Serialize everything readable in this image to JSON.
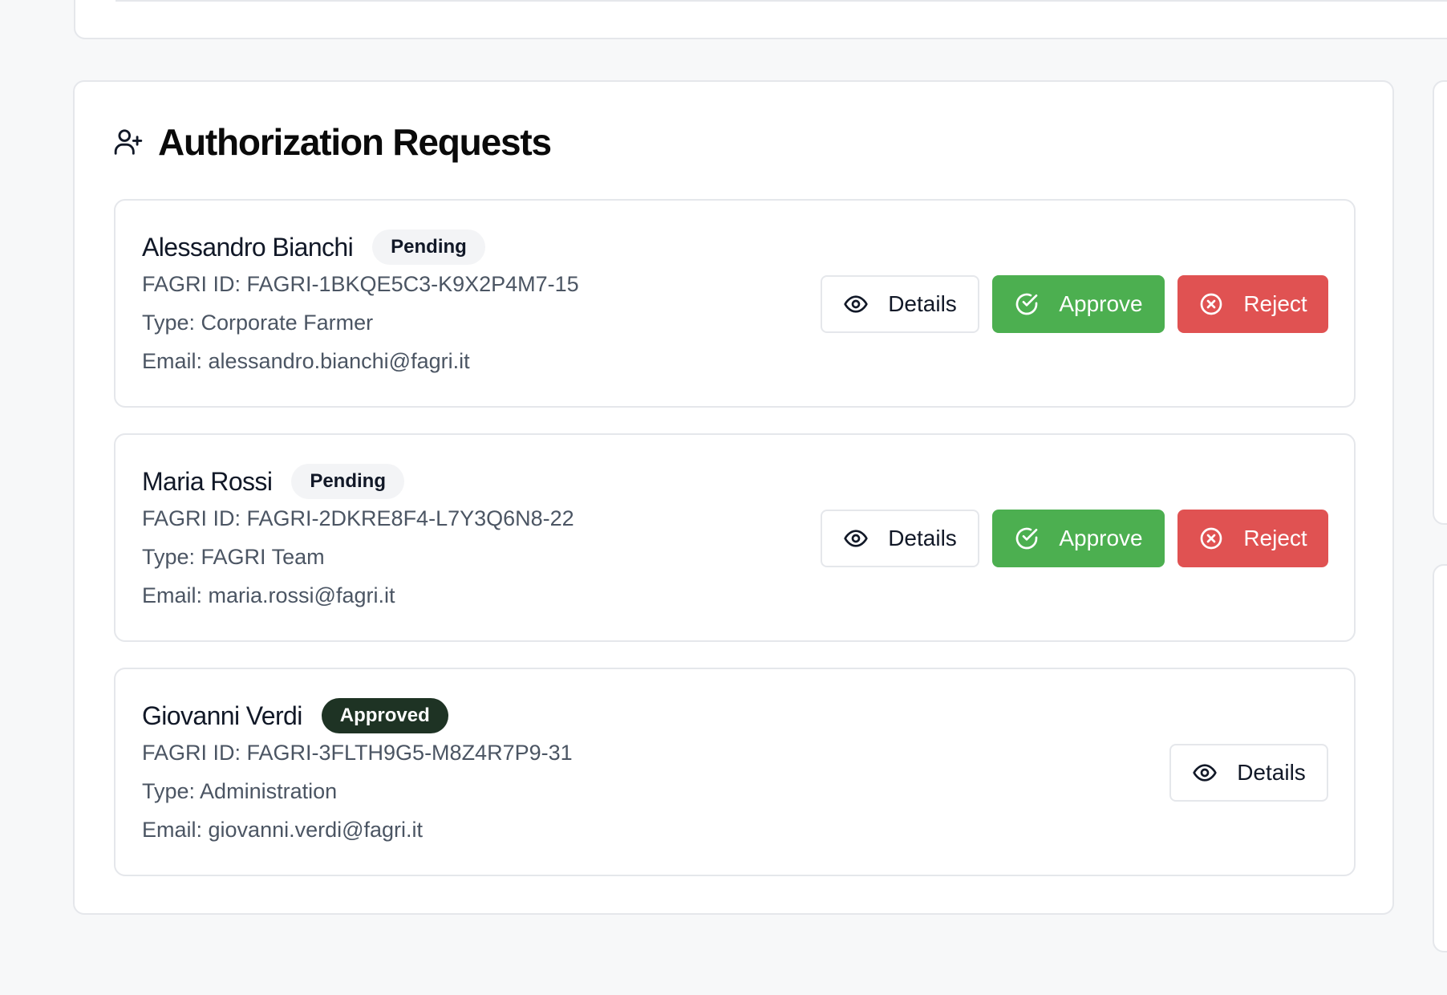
{
  "section": {
    "title": "Authorization Requests",
    "icon": "user-plus-icon"
  },
  "buttons": {
    "details": "Details",
    "approve": "Approve",
    "reject": "Reject"
  },
  "requests": [
    {
      "name": "Alessandro Bianchi",
      "status": "Pending",
      "fagri_id": "FAGRI ID: FAGRI-1BKQE5C3-K9X2P4M7-15",
      "type": "Type: Corporate Farmer",
      "email": "Email: alessandro.bianchi@fagri.it"
    },
    {
      "name": "Maria Rossi",
      "status": "Pending",
      "fagri_id": "FAGRI ID: FAGRI-2DKRE8F4-L7Y3Q6N8-22",
      "type": "Type: FAGRI Team",
      "email": "Email: maria.rossi@fagri.it"
    },
    {
      "name": "Giovanni Verdi",
      "status": "Approved",
      "fagri_id": "FAGRI ID: FAGRI-3FLTH9G5-M8Z4R7P9-31",
      "type": "Type: Administration",
      "email": "Email: giovanni.verdi@fagri.it"
    }
  ],
  "colors": {
    "approve": "#4caf50",
    "reject": "#e05252",
    "approved_badge": "#1e3324",
    "pending_badge": "#f3f4f6"
  }
}
